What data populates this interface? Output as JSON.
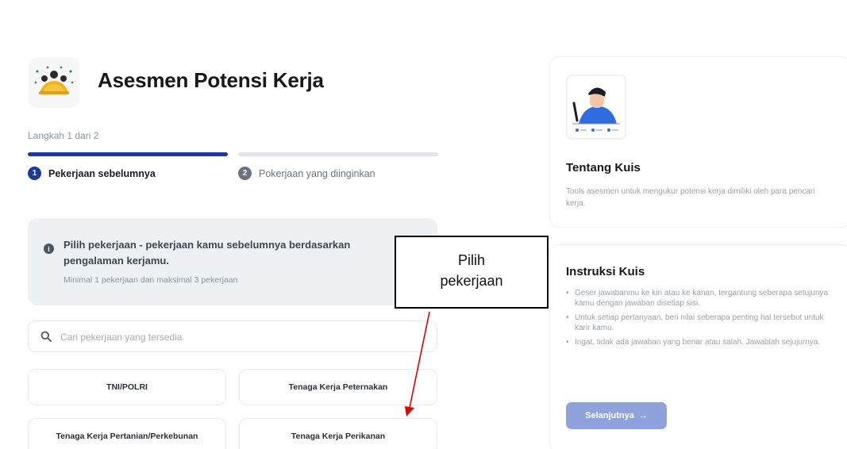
{
  "header": {
    "title": "Asesmen Potensi Kerja"
  },
  "stepper": {
    "step_text": "Langkah 1 dari 2",
    "steps": [
      {
        "number": "1",
        "label": "Pekerjaan sebelumnya",
        "state": "active"
      },
      {
        "number": "2",
        "label": "Pokerjaan yang diinginkan",
        "state": "inactive"
      }
    ]
  },
  "info_box": {
    "icon": "info-icon",
    "text": "Pilih pekerjaan - pekerjaan kamu sebelumnya berdasarkan pengalaman kerjamu.",
    "subtext": "Minimal 1 pekerjaan dan maksimal 3 pekerjaan"
  },
  "search": {
    "placeholder": "Cari pekerjaan yang tersedia",
    "icon": "search-icon"
  },
  "jobs": [
    "TNI/POLRI",
    "Tenaga Kerja Peternakan",
    "Tenaga Kerja Pertanian/Perkebunan",
    "Tenaga Kerja Perikanan"
  ],
  "annotation": {
    "line1": "Pilih",
    "line2": "pekerjaan"
  },
  "about_card": {
    "title": "Tentang Kuis",
    "description": "Tools asesmen untuk mengukur potensi kerja dimiliki oleh para pencari kerja."
  },
  "instructions_card": {
    "title": "Instruksi Kuis",
    "items": [
      "Geser jawabanmu ke kiri atau ke kanan, tergantung seberapa setujunya kamu dengan jawaban disetiap sisi.",
      "Untuk setiap pertanyaan, beri nilai seberapa penting hal tersebut untuk karir kamu.",
      "Ingat, tidak ada jawaban yang benar atau salah. Jawablah sejujurnya."
    ],
    "next_button": "Selanjutnya",
    "next_icon": "arrow-right-icon"
  },
  "colors": {
    "primary": "#1d3a9b",
    "button_disabled": "#8fa2de",
    "info_bg": "#eef1f4",
    "annotation_arrow": "#e00000"
  }
}
